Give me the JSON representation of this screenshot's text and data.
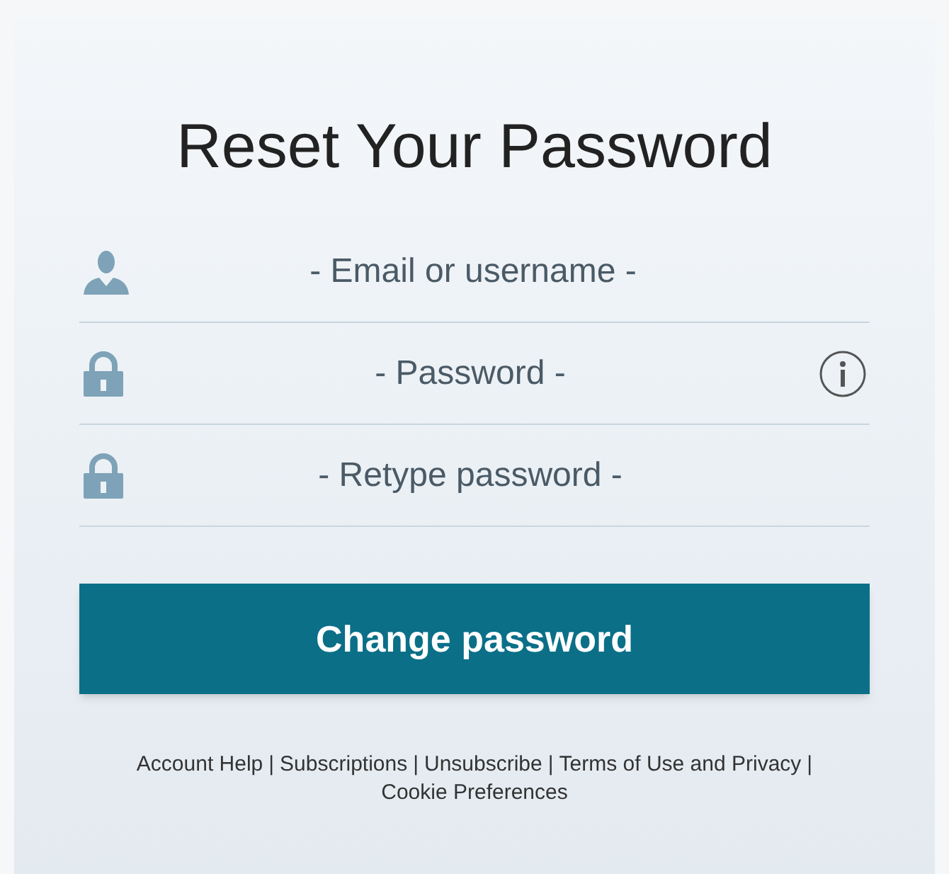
{
  "title": "Reset Your Password",
  "fields": [
    {
      "kind": "user",
      "placeholder": "- Email or username -",
      "info": false
    },
    {
      "kind": "lock",
      "placeholder": "- Password -",
      "info": true
    },
    {
      "kind": "lock",
      "placeholder": "- Retype password -",
      "info": false
    }
  ],
  "submit": "Change password",
  "footer": {
    "separator": "|",
    "links": [
      "Account Help",
      "Subscriptions",
      "Unsubscribe",
      "Terms of Use and Privacy",
      "Cookie Preferences"
    ]
  }
}
